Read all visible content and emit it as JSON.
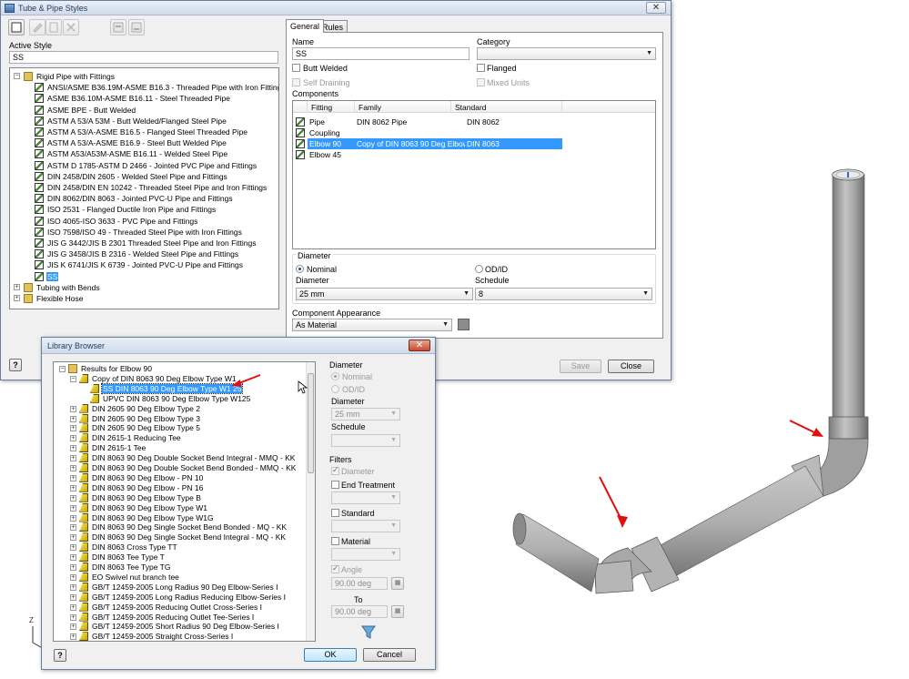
{
  "tube_pipe": {
    "title": "Tube & Pipe Styles",
    "active_style_label": "Active Style",
    "active_style_value": "SS",
    "tree": {
      "root": "Rigid Pipe with Fittings",
      "items": [
        "ANSI/ASME B36.19M-ASME B16.3 - Threaded Pipe with Iron Fittings",
        "ASME B36.10M-ASME B16.11 - Steel Threaded Pipe",
        "ASME BPE - Butt Welded",
        "ASTM A 53/A 53M - Butt Welded/Flanged Steel Pipe",
        "ASTM A 53/A-ASME B16.5 - Flanged Steel Threaded Pipe",
        "ASTM A 53/A-ASME B16.9 - Steel Butt Welded Pipe",
        "ASTM A53/A53M-ASME B16.11 - Welded Steel Pipe",
        "ASTM D 1785-ASTM D 2466 - Jointed PVC Pipe and Fittings",
        "DIN 2458/DIN 2605 - Welded Steel Pipe and Fittings",
        "DIN 2458/DIN EN 10242 - Threaded Steel Pipe and Iron Fittings",
        "DIN 8062/DIN 8063 - Jointed PVC-U Pipe and Fittings",
        "ISO 2531 - Flanged Ductile Iron Pipe and Fittings",
        "ISO 4065-ISO 3633 - PVC Pipe and Fittings",
        "ISO 7598/ISO 49 - Threaded Steel Pipe with Iron Fittings",
        "JIS G 3442/JIS B 2301 Threaded Steel Pipe and Iron Fittings",
        "JIS G 3458/JIS B 2316 -  Welded Steel Pipe and Fittings",
        "JIS K 6741/JIS K 6739 - Jointed PVC-U Pipe and Fittings",
        "SS"
      ],
      "others": [
        "Tubing with Bends",
        "Flexible Hose"
      ]
    },
    "tabs": [
      "General",
      "Rules"
    ],
    "name_label": "Name",
    "name_value": "SS",
    "category_label": "Category",
    "category_value": "",
    "butt_welded": "Butt Welded",
    "flanged": "Flanged",
    "self_draining": "Self Draining",
    "mixed_units": "Mixed Units",
    "components_label": "Components",
    "grid_headers": [
      "Fitting",
      "Family",
      "Standard"
    ],
    "rows": [
      {
        "fitting": "Pipe",
        "family": "DIN 8062 Pipe",
        "standard": "DIN 8062"
      },
      {
        "fitting": "Coupling",
        "family": "",
        "standard": ""
      },
      {
        "fitting": "Elbow 90",
        "family": "Copy of DIN 8063 90 Deg Elbow Type W1",
        "standard": "DIN 8063"
      },
      {
        "fitting": "Elbow 45",
        "family": "",
        "standard": ""
      }
    ],
    "diameter_group": "Diameter",
    "nominal": "Nominal",
    "odid": "OD/ID",
    "diameter_label": "Diameter",
    "diameter_value": "25 mm",
    "schedule_label": "Schedule",
    "schedule_value": "8",
    "appearance_label": "Component Appearance",
    "appearance_value": "As Material",
    "save": "Save",
    "close": "Close"
  },
  "library": {
    "title": "Library Browser",
    "results_root": "Results for Elbow 90",
    "expanded": "Copy of DIN 8063 90 Deg Elbow Type W1",
    "children": [
      "SS DIN 8063 90 Deg Elbow Type W1 25",
      "UPVC DIN 8063 90 Deg Elbow Type W125"
    ],
    "items": [
      "DIN 2605 90 Deg Elbow Type 2",
      "DIN 2605 90 Deg Elbow Type 3",
      "DIN 2605 90 Deg Elbow Type 5",
      "DIN 2615-1 Reducing Tee",
      "DIN 2615-1 Tee",
      "DIN 8063 90 Deg Double Socket Bend Integral - MMQ - KK",
      "DIN 8063 90 Deg Double Socket Bend Bonded - MMQ - KK",
      "DIN 8063 90 Deg Elbow - PN 10",
      "DIN 8063 90 Deg Elbow - PN 16",
      "DIN 8063 90 Deg Elbow Type B",
      "DIN 8063 90 Deg Elbow Type W1",
      "DIN 8063 90 Deg Elbow Type W1G",
      "DIN 8063 90 Deg Single Socket Bend Bonded - MQ - KK",
      "DIN 8063 90 Deg Single Socket Bend Integral - MQ - KK",
      "DIN 8063 Cross Type TT",
      "DIN 8063 Tee Type T",
      "DIN 8063 Tee Type TG",
      "EO Swivel nut branch tee",
      "GB/T 12459-2005 Long Radius 90 Deg Elbow-Series I",
      "GB/T 12459-2005 Long Radius Reducing Elbow-Series I",
      "GB/T 12459-2005 Reducing Outlet Cross-Series I",
      "GB/T 12459-2005 Reducing Outlet Tee-Series I",
      "GB/T 12459-2005 Short Radius 90 Deg Elbow-Series I",
      "GB/T 12459-2005 Straight Cross-Series I"
    ],
    "diameter_group": "Diameter",
    "nominal": "Nominal",
    "odid": "OD/ID",
    "diameter_label": "Diameter",
    "diameter_value": "25 mm",
    "schedule_label": "Schedule",
    "filters": "Filters",
    "f_diameter": "Diameter",
    "f_end": "End Treatment",
    "f_standard": "Standard",
    "f_material": "Material",
    "f_angle": "Angle",
    "angle_from": "90.00 deg",
    "to": "To",
    "angle_to": "90.00 deg",
    "ok": "OK",
    "cancel": "Cancel"
  },
  "colors": {
    "accent": "#3399ff",
    "arrow": "#e01010",
    "pipe": "#a9a9a9"
  }
}
